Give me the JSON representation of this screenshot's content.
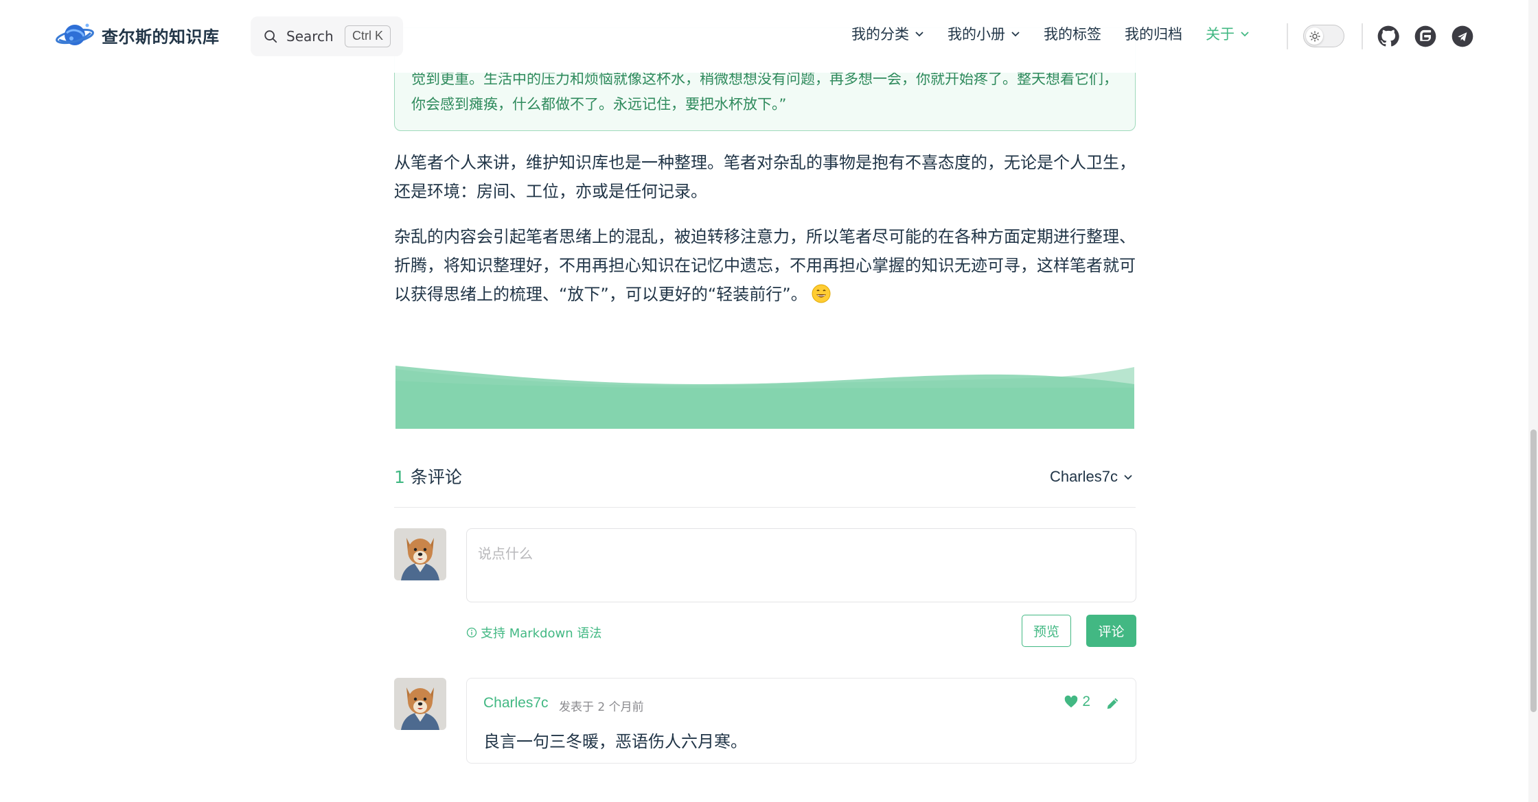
{
  "site": {
    "title": "查尔斯的知识库"
  },
  "search": {
    "label": "Search",
    "shortcut": "Ctrl K"
  },
  "nav": {
    "items": [
      {
        "label": "我的分类",
        "dropdown": true,
        "active": false
      },
      {
        "label": "我的小册",
        "dropdown": true,
        "active": false
      },
      {
        "label": "我的标签",
        "dropdown": false,
        "active": false
      },
      {
        "label": "我的归档",
        "dropdown": false,
        "active": false
      },
      {
        "label": "关于",
        "dropdown": true,
        "active": true
      }
    ],
    "social_icons": [
      "github-icon",
      "gitee-icon",
      "telegram-icon"
    ]
  },
  "article": {
    "quote_lines": [
      "觉到更重。生活中的压力和烦恼就像这杯水，稍微想想没有问题，再多想一会，你就开始疼了。整天想着它们，",
      "你会感到瘫痪，什么都做不了。永远记住，要把水杯放下。”"
    ],
    "paragraph1_lines": [
      "从笔者个人来讲，维护知识库也是一种整理。笔者对杂乱的事物是抱有不喜态度的，无论是个人卫生，",
      "还是环境：房间、工位，亦或是任何记录。"
    ],
    "paragraph2_lines": [
      "杂乱的内容会引起笔者思绪上的混乱，被迫转移注意力，所以笔者尽可能的在各种方面定期进行整理、",
      "折腾，将知识整理好，不用再担心知识在记忆中遗忘，不用再担心掌握的知识无迹可寻，这样笔者就可",
      "以获得思绪上的梳理、“放下”，可以更好的“轻装前行”。"
    ]
  },
  "comments": {
    "count": "1",
    "count_suffix": "条评论",
    "current_user": "Charles7c",
    "placeholder": "说点什么",
    "markdown_hint": "支持 Markdown 语法",
    "preview_label": "预览",
    "submit_label": "评论",
    "list": [
      {
        "author": "Charles7c",
        "posted_prefix": "发表于",
        "time": "2 个月前",
        "likes": "2",
        "text": "良言一句三冬暖，恶语伤人六月寒。"
      }
    ]
  },
  "colors": {
    "accent": "#42b883",
    "text": "#213547",
    "quote_bg": "#f2fbf6",
    "wave": "#84d4ae"
  }
}
